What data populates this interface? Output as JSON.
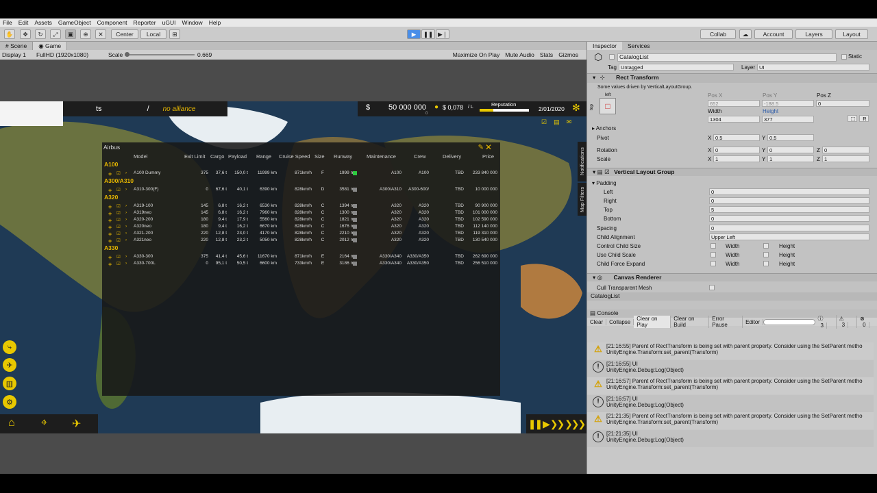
{
  "menu": [
    "File",
    "Edit",
    "Assets",
    "GameObject",
    "Component",
    "Reporter",
    "uGUI",
    "Window",
    "Help"
  ],
  "toolbar": {
    "center": "Center",
    "local": "Local",
    "collab": "Collab",
    "account": "Account",
    "layers": "Layers",
    "layout": "Layout"
  },
  "tabs": {
    "scene": "Scene",
    "game": "Game"
  },
  "gamebar": {
    "display": "Display 1",
    "resolution": "FullHD (1920x1080)",
    "scale_label": "Scale",
    "scale_value": "0.669",
    "maximize": "Maximize On Play",
    "mute": "Mute Audio",
    "stats": "Stats",
    "gizmos": "Gizmos"
  },
  "hud": {
    "name": "ts",
    "slash": "/",
    "alliance": "no alliance",
    "currency": "$",
    "money": "50 000 000",
    "money_sub": "0",
    "fuel": "$ 0,078",
    "fuel_unit": "/ L",
    "reputation": "Reputation",
    "date": "2/01/2020"
  },
  "panel": {
    "title": "Airbus",
    "headers": [
      "Model",
      "Exit Limit",
      "Cargo",
      "Payload",
      "Range",
      "Cruise Speed",
      "Size",
      "Runway",
      "Maintenance",
      "Crew",
      "Delivery",
      "Price"
    ],
    "groups": [
      {
        "name": "A100",
        "rows": [
          [
            "A100 Dummy",
            "375",
            "37,6 t",
            "150,0 t",
            "11999 km",
            "871km/h",
            "F",
            "1999 m",
            "A100",
            "A100",
            "TBD",
            "233 840 000"
          ]
        ]
      },
      {
        "name": "A300/A310",
        "rows": [
          [
            "A310-300(F)",
            "0",
            "67,6 t",
            "40,1 t",
            "6390 km",
            "828km/h",
            "D",
            "3581 m",
            "A300/A310",
            "A300-600/",
            "TBD",
            "10 000 000"
          ]
        ]
      },
      {
        "name": "A320",
        "rows": [
          [
            "A319-100",
            "145",
            "6,8 t",
            "16,2 t",
            "6530 km",
            "828km/h",
            "C",
            "1394 m",
            "A320",
            "A320",
            "TBD",
            "90 900 000"
          ],
          [
            "A319neo",
            "145",
            "6,8 t",
            "16,2 t",
            "7960 km",
            "828km/h",
            "C",
            "1300 m",
            "A320",
            "A320",
            "TBD",
            "101 000 000"
          ],
          [
            "A320-200",
            "180",
            "9,4 t",
            "17,9 t",
            "5560 km",
            "828km/h",
            "C",
            "1821 m",
            "A320",
            "A320",
            "TBD",
            "102 590 000"
          ],
          [
            "A320neo",
            "180",
            "9,4 t",
            "16,2 t",
            "6670 km",
            "828km/h",
            "C",
            "1676 m",
            "A320",
            "A320",
            "TBD",
            "112 140 000"
          ],
          [
            "A321-200",
            "220",
            "12,8 t",
            "23,0 t",
            "4170 km",
            "828km/h",
            "C",
            "2210 m",
            "A320",
            "A320",
            "TBD",
            "119 310 000"
          ],
          [
            "A321neo",
            "220",
            "12,8 t",
            "23,2 t",
            "5050 km",
            "828km/h",
            "C",
            "2012 m",
            "A320",
            "A320",
            "TBD",
            "130 540 000"
          ]
        ]
      },
      {
        "name": "A330",
        "rows": [
          [
            "A330-300",
            "375",
            "41,4 t",
            "45,6 t",
            "11670 km",
            "871km/h",
            "E",
            "2164 m",
            "A330/A340",
            "A330/A350",
            "TBD",
            "262 690 000"
          ],
          [
            "A330-700L",
            "0",
            "95,1 t",
            "50,5 t",
            "6600 km",
            "733km/h",
            "E",
            "3186 m",
            "A330/A340",
            "A330/A350",
            "TBD",
            "256 510 000"
          ]
        ]
      }
    ]
  },
  "vtabs": {
    "notifications": "Notifications",
    "filters": "Map Filters"
  },
  "inspector": {
    "tabs": [
      "Inspector",
      "Services"
    ],
    "object_name": "CatalogList",
    "static": "Static",
    "tag_label": "Tag",
    "tag_value": "Untagged",
    "layer_label": "Layer",
    "layer_value": "UI",
    "rect_title": "Rect Transform",
    "rect_note": "Some values driven by VerticalLayoutGroup.",
    "anchor_left": "left",
    "anchor_top": "top",
    "posx_label": "Pos X",
    "posx": "652",
    "posy_label": "Pos Y",
    "posy": "-188.5",
    "posz_label": "Pos Z",
    "posz": "0",
    "width_label": "Width",
    "width": "1304",
    "height_label": "Height",
    "height": "377",
    "anchors": "Anchors",
    "pivot": "Pivot",
    "pivot_x": "0.5",
    "pivot_y": "0.5",
    "rotation": "Rotation",
    "rot_x": "0",
    "rot_y": "0",
    "rot_z": "0",
    "scale": "Scale",
    "scale_x": "1",
    "scale_y": "1",
    "scale_z": "1",
    "x": "X",
    "y": "Y",
    "z": "Z",
    "r": "R",
    "vlg_title": "Vertical Layout Group",
    "padding": "Padding",
    "left": "Left",
    "left_v": "0",
    "right": "Right",
    "right_v": "0",
    "top": "Top",
    "top_v": "5",
    "bottom": "Bottom",
    "bottom_v": "0",
    "spacing": "Spacing",
    "spacing_v": "0",
    "child_align": "Child Alignment",
    "child_align_v": "Upper Left",
    "ctrl_size": "Control Child Size",
    "use_scale": "Use Child Scale",
    "force_expand": "Child Force Expand",
    "w": "Width",
    "h": "Height",
    "canvas_renderer": "Canvas Renderer",
    "cull": "Cull Transparent Mesh",
    "footer": "CatalogList"
  },
  "console": {
    "title": "Console",
    "buttons": [
      "Clear",
      "Collapse",
      "Clear on Play",
      "Clear on Build",
      "Error Pause",
      "Editor"
    ],
    "count_info": "3",
    "count_warn": "3",
    "count_err": "0",
    "logs": [
      {
        "type": "warn",
        "l1": "[21:16:55] Parent of RectTransform is being set with parent property. Consider using the SetParent metho",
        "l2": "UnityEngine.Transform:set_parent(Transform)"
      },
      {
        "type": "info",
        "l1": "[21:16:55] UI",
        "l2": "UnityEngine.Debug:Log(Object)"
      },
      {
        "type": "warn",
        "l1": "[21:16:57] Parent of RectTransform is being set with parent property. Consider using the SetParent metho",
        "l2": "UnityEngine.Transform:set_parent(Transform)"
      },
      {
        "type": "info",
        "l1": "[21:16:57] UI",
        "l2": "UnityEngine.Debug:Log(Object)"
      },
      {
        "type": "warn",
        "l1": "[21:21:35] Parent of RectTransform is being set with parent property. Consider using the SetParent metho",
        "l2": "UnityEngine.Transform:set_parent(Transform)"
      },
      {
        "type": "info",
        "l1": "[21:21:35] UI",
        "l2": "UnityEngine.Debug:Log(Object)"
      }
    ]
  },
  "colors": {
    "accent": "#e8b800",
    "ocean": "#1f3a55"
  }
}
